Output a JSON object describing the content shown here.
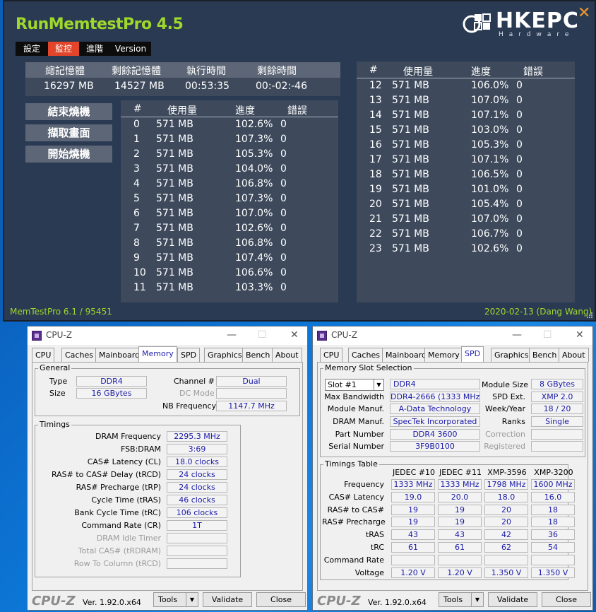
{
  "runmemtest": {
    "title": "RunMemtestPro 4.5",
    "logo": "HKEPC",
    "logo_sub": "Hardware",
    "menu": [
      "設定",
      "監控",
      "進階",
      "Version"
    ],
    "summary_headers": [
      "總記憶體",
      "剩餘記憶體",
      "執行時間",
      "剩餘時間"
    ],
    "summary_values": [
      "16297 MB",
      "14527 MB",
      "00:53:35",
      "00:-02:-46"
    ],
    "buttons": [
      "結束燒機",
      "擷取畫面",
      "開始燒機"
    ],
    "table_headers": [
      "#",
      "使用量",
      "進度",
      "錯誤"
    ],
    "left_rows": [
      [
        "0",
        "571 MB",
        "102.6%",
        "0"
      ],
      [
        "1",
        "571 MB",
        "107.3%",
        "0"
      ],
      [
        "2",
        "571 MB",
        "105.3%",
        "0"
      ],
      [
        "3",
        "571 MB",
        "104.0%",
        "0"
      ],
      [
        "4",
        "571 MB",
        "106.8%",
        "0"
      ],
      [
        "5",
        "571 MB",
        "107.3%",
        "0"
      ],
      [
        "6",
        "571 MB",
        "107.0%",
        "0"
      ],
      [
        "7",
        "571 MB",
        "102.6%",
        "0"
      ],
      [
        "8",
        "571 MB",
        "106.8%",
        "0"
      ],
      [
        "9",
        "571 MB",
        "107.4%",
        "0"
      ],
      [
        "10",
        "571 MB",
        "106.6%",
        "0"
      ],
      [
        "11",
        "571 MB",
        "103.3%",
        "0"
      ]
    ],
    "right_rows": [
      [
        "12",
        "571 MB",
        "106.0%",
        "0"
      ],
      [
        "13",
        "571 MB",
        "107.0%",
        "0"
      ],
      [
        "14",
        "571 MB",
        "107.1%",
        "0"
      ],
      [
        "15",
        "571 MB",
        "103.0%",
        "0"
      ],
      [
        "16",
        "571 MB",
        "105.3%",
        "0"
      ],
      [
        "17",
        "571 MB",
        "107.1%",
        "0"
      ],
      [
        "18",
        "571 MB",
        "106.5%",
        "0"
      ],
      [
        "19",
        "571 MB",
        "101.0%",
        "0"
      ],
      [
        "20",
        "571 MB",
        "105.4%",
        "0"
      ],
      [
        "21",
        "571 MB",
        "107.0%",
        "0"
      ],
      [
        "22",
        "571 MB",
        "106.7%",
        "0"
      ],
      [
        "23",
        "571 MB",
        "102.6%",
        "0"
      ]
    ],
    "footer_left": "MemTestPro 6.1 / 95451",
    "footer_right": "2020-02-13 (Dang Wang)"
  },
  "cpuz_common": {
    "title": "CPU-Z",
    "tabs": [
      "CPU",
      "Caches",
      "Mainboard",
      "Memory",
      "SPD",
      "Graphics",
      "Bench",
      "About"
    ],
    "logo": "CPU-Z",
    "version": "Ver. 1.92.0.x64",
    "tools": "Tools",
    "validate": "Validate",
    "close": "Close"
  },
  "memory": {
    "general_label": "General",
    "type_label": "Type",
    "type": "DDR4",
    "size_label": "Size",
    "size": "16 GBytes",
    "channel_label": "Channel #",
    "channel": "Dual",
    "dc_label": "DC Mode",
    "dc": "",
    "nb_label": "NB Frequency",
    "nb": "1147.7 MHz",
    "timings_label": "Timings",
    "timings": [
      {
        "label": "DRAM Frequency",
        "value": "2295.3 MHz",
        "disabled": false
      },
      {
        "label": "FSB:DRAM",
        "value": "3:69",
        "disabled": false
      },
      {
        "label": "CAS# Latency (CL)",
        "value": "18.0 clocks",
        "disabled": false
      },
      {
        "label": "RAS# to CAS# Delay (tRCD)",
        "value": "24 clocks",
        "disabled": false
      },
      {
        "label": "RAS# Precharge (tRP)",
        "value": "24 clocks",
        "disabled": false
      },
      {
        "label": "Cycle Time (tRAS)",
        "value": "46 clocks",
        "disabled": false
      },
      {
        "label": "Bank Cycle Time (tRC)",
        "value": "106 clocks",
        "disabled": false
      },
      {
        "label": "Command Rate (CR)",
        "value": "1T",
        "disabled": false
      },
      {
        "label": "DRAM Idle Timer",
        "value": "",
        "disabled": true
      },
      {
        "label": "Total CAS# (tRDRAM)",
        "value": "",
        "disabled": true
      },
      {
        "label": "Row To Column (tRCD)",
        "value": "",
        "disabled": true
      }
    ]
  },
  "spd": {
    "slot_label": "Memory Slot Selection",
    "slot": "Slot #1",
    "slot_type": "DDR4",
    "max_bw_label": "Max Bandwidth",
    "max_bw": "DDR4-2666 (1333 MHz)",
    "module_manuf_label": "Module Manuf.",
    "module_manuf": "A-Data Technology",
    "dram_manuf_label": "DRAM Manuf.",
    "dram_manuf": "SpecTek Incorporated",
    "part_label": "Part Number",
    "part": "DDR4 3600",
    "serial_label": "Serial Number",
    "serial": "3F9B0100",
    "module_size_label": "Module Size",
    "module_size": "8 GBytes",
    "spd_ext_label": "SPD Ext.",
    "spd_ext": "XMP 2.0",
    "week_label": "Week/Year",
    "week": "18 / 20",
    "ranks_label": "Ranks",
    "ranks": "Single",
    "correction_label": "Correction",
    "correction": "",
    "registered_label": "Registered",
    "registered": "",
    "timings_label": "Timings Table",
    "columns": [
      "JEDEC #10",
      "JEDEC #11",
      "XMP-3596",
      "XMP-3200"
    ],
    "rows": [
      {
        "label": "Frequency",
        "values": [
          "1333 MHz",
          "1333 MHz",
          "1798 MHz",
          "1600 MHz"
        ]
      },
      {
        "label": "CAS# Latency",
        "values": [
          "19.0",
          "20.0",
          "18.0",
          "16.0"
        ]
      },
      {
        "label": "RAS# to CAS#",
        "values": [
          "19",
          "19",
          "20",
          "18"
        ]
      },
      {
        "label": "RAS# Precharge",
        "values": [
          "19",
          "19",
          "20",
          "18"
        ]
      },
      {
        "label": "tRAS",
        "values": [
          "43",
          "43",
          "42",
          "36"
        ]
      },
      {
        "label": "tRC",
        "values": [
          "61",
          "61",
          "62",
          "54"
        ]
      },
      {
        "label": "Command Rate",
        "values": [
          "",
          "",
          "",
          ""
        ]
      },
      {
        "label": "Voltage",
        "values": [
          "1.20 V",
          "1.20 V",
          "1.350 V",
          "1.350 V"
        ]
      }
    ]
  }
}
